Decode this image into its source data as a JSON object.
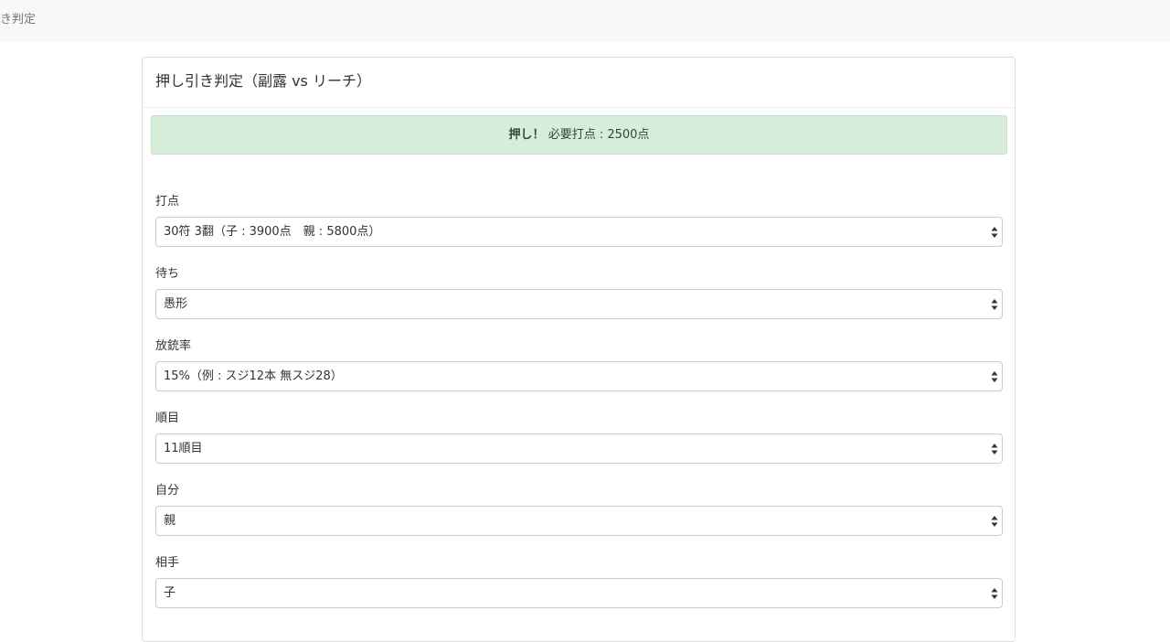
{
  "navbar": {
    "brand": "き判定"
  },
  "panel": {
    "title": "押し引き判定（副露 vs リーチ）"
  },
  "result": {
    "verdict": "押し！",
    "detail": " 必要打点 : 2500点"
  },
  "fields": [
    {
      "label": "打点",
      "value": "30符 3翻（子 : 3900点　親 : 5800点）"
    },
    {
      "label": "待ち",
      "value": "愚形"
    },
    {
      "label": "放銃率",
      "value": "15%（例 : スジ12本 無スジ28）"
    },
    {
      "label": "順目",
      "value": "11順目"
    },
    {
      "label": "自分",
      "value": "親"
    },
    {
      "label": "相手",
      "value": "子"
    }
  ],
  "icons": {
    "select_arrows": "up-down-caret-icon"
  },
  "colors": {
    "alert_background": "#d6edd9",
    "alert_text": "#2f4a33",
    "navbar_background": "#f8f8f8"
  }
}
